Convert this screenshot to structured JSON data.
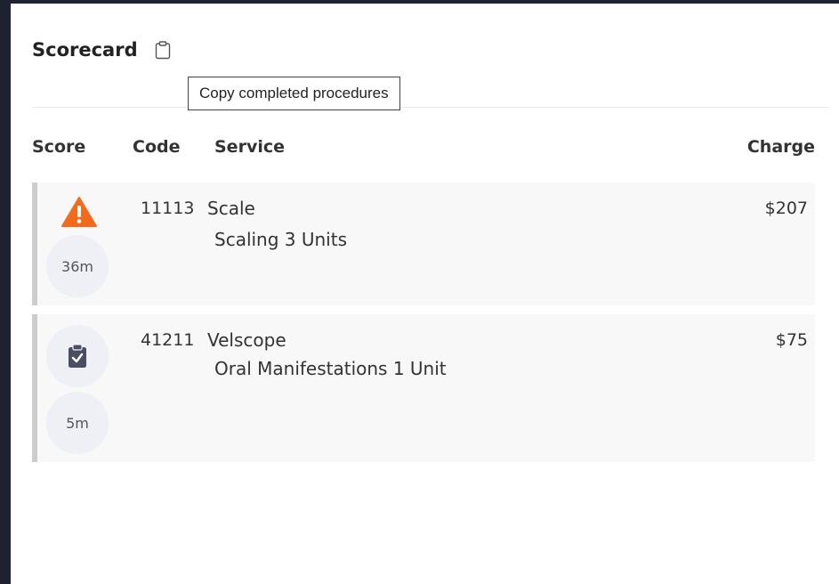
{
  "scorecard": {
    "title": "Scorecard",
    "copy_tooltip": "Copy completed procedures"
  },
  "columns": {
    "score": "Score",
    "code": "Code",
    "service": "Service",
    "charge": "Charge"
  },
  "procedures": [
    {
      "status_icon": "warning-icon",
      "time": "36m",
      "code": "11113",
      "service": "Scale",
      "detail": "Scaling 3 Units",
      "charge": "$207"
    },
    {
      "status_icon": "clipboard-check-icon",
      "time": "5m",
      "code": "41211",
      "service": "Velscope",
      "detail": "Oral Manifestations 1 Unit",
      "charge": "$75"
    }
  ],
  "colors": {
    "background": "#1e2130",
    "warning": "#f26b1d",
    "clipboard": "#4a4e63",
    "row_bg": "#f8f8f9",
    "row_border": "#cdcdcd"
  }
}
